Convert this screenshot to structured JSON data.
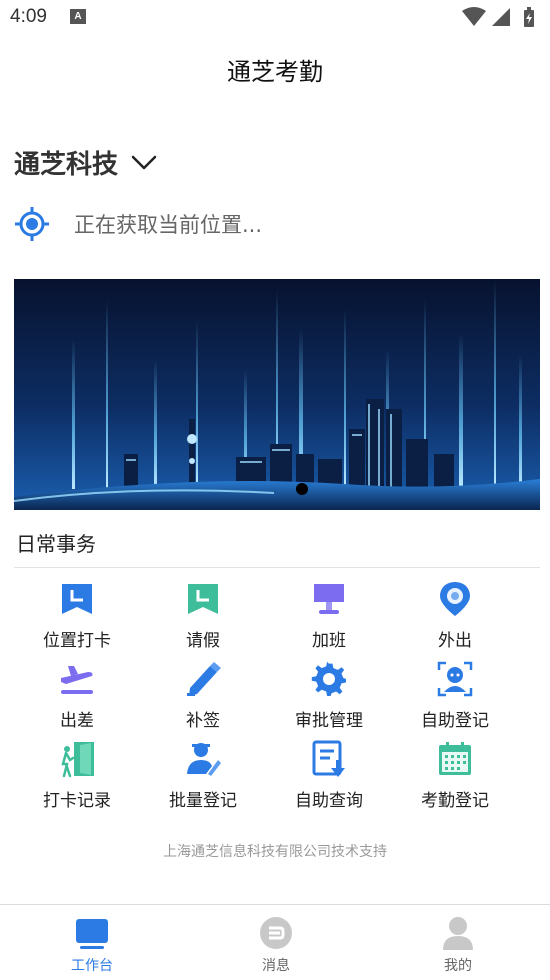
{
  "status_bar": {
    "time": "4:09",
    "notification_badge": "A",
    "icons": [
      "wifi-icon",
      "cellular-signal-icon",
      "battery-icon"
    ]
  },
  "app": {
    "title": "通芝考勤"
  },
  "company": {
    "name": "通芝科技",
    "dropdown_icon": "chevron-down-icon"
  },
  "location": {
    "icon": "location-target-icon",
    "text": "正在获取当前位置..."
  },
  "banner": {
    "slides_count": 1,
    "active_index": 0,
    "image": "city-skyline-night"
  },
  "daily_affairs": {
    "title": "日常事务",
    "items": [
      {
        "label": "位置打卡",
        "icon": "location-checkin-icon"
      },
      {
        "label": "请假",
        "icon": "leave-icon"
      },
      {
        "label": "加班",
        "icon": "overtime-icon"
      },
      {
        "label": "外出",
        "icon": "outing-icon"
      },
      {
        "label": "出差",
        "icon": "business-trip-icon"
      },
      {
        "label": "补签",
        "icon": "resign-icon"
      },
      {
        "label": "审批管理",
        "icon": "approval-settings-icon"
      },
      {
        "label": "自助登记",
        "icon": "self-register-icon"
      },
      {
        "label": "打卡记录",
        "icon": "checkin-records-icon"
      },
      {
        "label": "批量登记",
        "icon": "batch-register-icon"
      },
      {
        "label": "自助查询",
        "icon": "self-query-icon"
      },
      {
        "label": "考勤登记",
        "icon": "attendance-register-icon"
      }
    ]
  },
  "footer": {
    "support_text": "上海通芝信息科技有限公司技术支持"
  },
  "tabbar": {
    "tabs": [
      {
        "label": "工作台",
        "icon": "workbench-icon",
        "active": true
      },
      {
        "label": "消息",
        "icon": "message-icon",
        "active": false
      },
      {
        "label": "我的",
        "icon": "profile-icon",
        "active": false
      }
    ]
  },
  "colors": {
    "primary": "#2c7be5",
    "teal": "#3dbd9a",
    "purple": "#7b6cf0",
    "text_muted": "#999999"
  }
}
